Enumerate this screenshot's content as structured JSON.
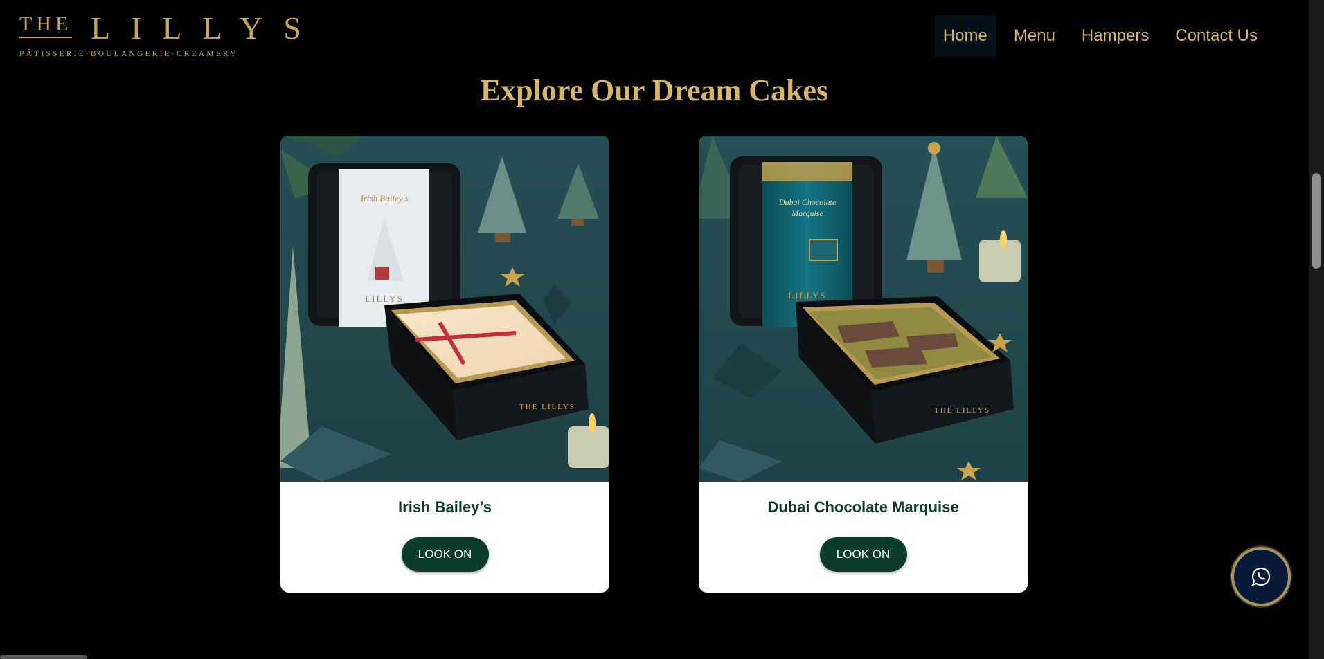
{
  "brand": {
    "the": "THE",
    "name": "LILLYS",
    "tagline": "PÂTISSERIE·BOULANGERIE·CREAMERY",
    "color": "#c7a55c"
  },
  "nav": {
    "items": [
      {
        "label": "Home",
        "active": true
      },
      {
        "label": "Menu",
        "active": false
      },
      {
        "label": "Hampers",
        "active": false
      },
      {
        "label": "Contact Us",
        "active": false
      }
    ]
  },
  "section": {
    "title": "Explore Our Dream Cakes"
  },
  "products": [
    {
      "name": "Irish Bailey’s",
      "button_label": "LOOK ON",
      "sleeve_text": "Irish Bailey's",
      "sleeve_brand": "LILLYS",
      "tin_brand": "THE LILLYS"
    },
    {
      "name": "Dubai Chocolate Marquise",
      "button_label": "LOOK ON",
      "sleeve_text_1": "Dubai Chocolate",
      "sleeve_text_2": "Marquise",
      "sleeve_brand": "LILLYS",
      "tin_brand": "THE LILLYS"
    }
  ],
  "whatsapp": {
    "icon": "whatsapp-icon"
  },
  "colors": {
    "background": "#000000",
    "gold": "#d4b56a",
    "button_green": "#0c3d2c",
    "product_title": "#0e3a2e"
  }
}
